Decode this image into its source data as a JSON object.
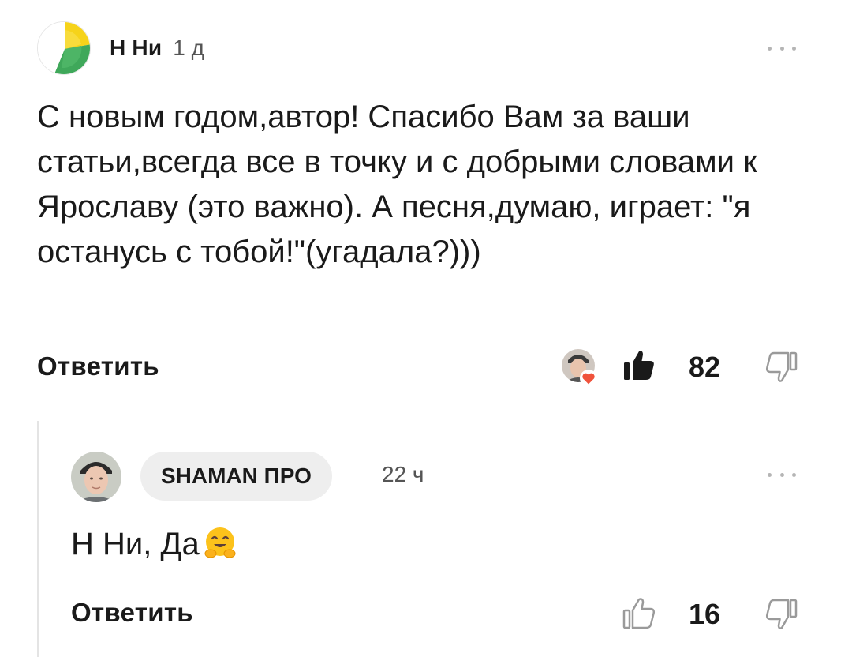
{
  "comment": {
    "author": "Н Ни",
    "time": "1 д",
    "text": "С новым годом,автор! Спасибо Вам за ваши статьи,всегда все в точку и с добрыми словами к Ярославу (это важно). А песня,думаю, играет: \"я останусь с тобой!\"(угадала?)))",
    "reply_label": "Ответить",
    "likes": "82",
    "liked": true,
    "avatar_icon": "yandex-zen-logo-icon"
  },
  "reply": {
    "author": "SHAMAN ПРО",
    "time": "22 ч",
    "text": "Н Ни, Да",
    "emoji": "hugging-face-icon",
    "reply_label": "Ответить",
    "likes": "16",
    "liked": false
  },
  "colors": {
    "text": "#1a1a1a",
    "muted": "#555555",
    "pill_bg": "#eeeeee",
    "thread_line": "#e4e4e4",
    "heart": "#f0533c"
  }
}
